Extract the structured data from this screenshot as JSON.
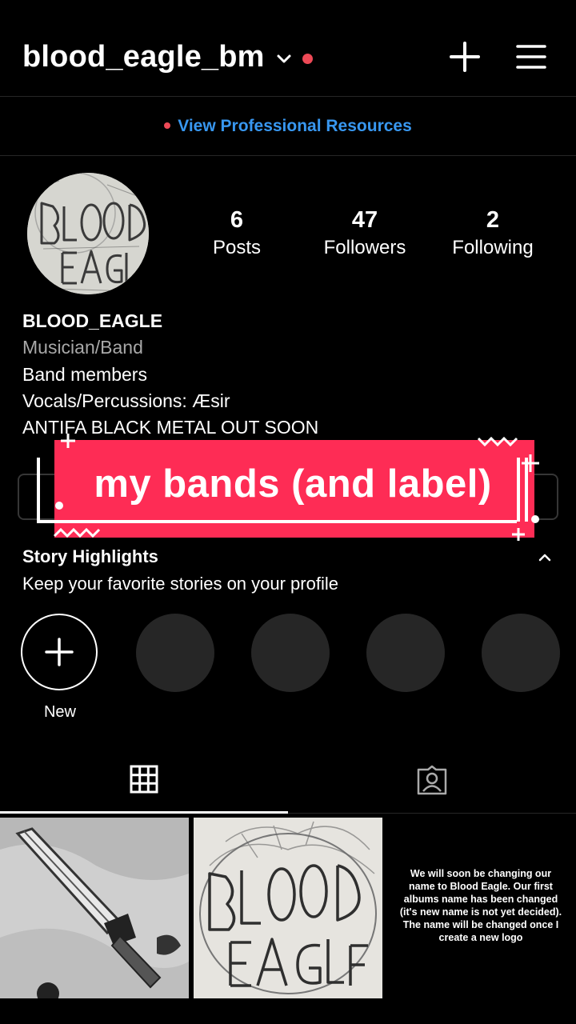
{
  "header": {
    "username": "blood_eagle_bm",
    "icons": [
      "chevron-down-icon",
      "notification-dot",
      "plus-icon",
      "hamburger-menu-icon"
    ]
  },
  "professional": {
    "label": "View Professional Resources"
  },
  "profile": {
    "avatar_text": "BLOOD EAGLE",
    "stats": [
      {
        "value": "6",
        "label": "Posts"
      },
      {
        "value": "47",
        "label": "Followers"
      },
      {
        "value": "2",
        "label": "Following"
      }
    ],
    "name": "BLOOD_EAGLE",
    "category": "Musician/Band",
    "bio_lines": [
      "Band members",
      "Vocals/Percussions: Æsir",
      "ANTIFA BLACK METAL OUT SOON"
    ]
  },
  "overlay": {
    "text": "my bands (and label)"
  },
  "highlights": {
    "title": "Story Highlights",
    "subtitle": "Keep your favorite stories on your profile",
    "new_label": "New"
  },
  "tabs": [
    "grid-icon",
    "tagged-icon"
  ],
  "posts": [
    {
      "kind": "image",
      "description": "dagger-sketch"
    },
    {
      "kind": "image",
      "description": "blood-eagle-logo-sketch"
    },
    {
      "kind": "text",
      "text": "We will soon be changing our name to Blood Eagle. Our first albums name has been changed (it's new name is not yet decided). The name will be changed once I create a new logo"
    }
  ],
  "colors": {
    "accent_red": "#ED4956",
    "link_blue": "#3897F0",
    "banner": "#FE2C55",
    "background": "#000000"
  }
}
